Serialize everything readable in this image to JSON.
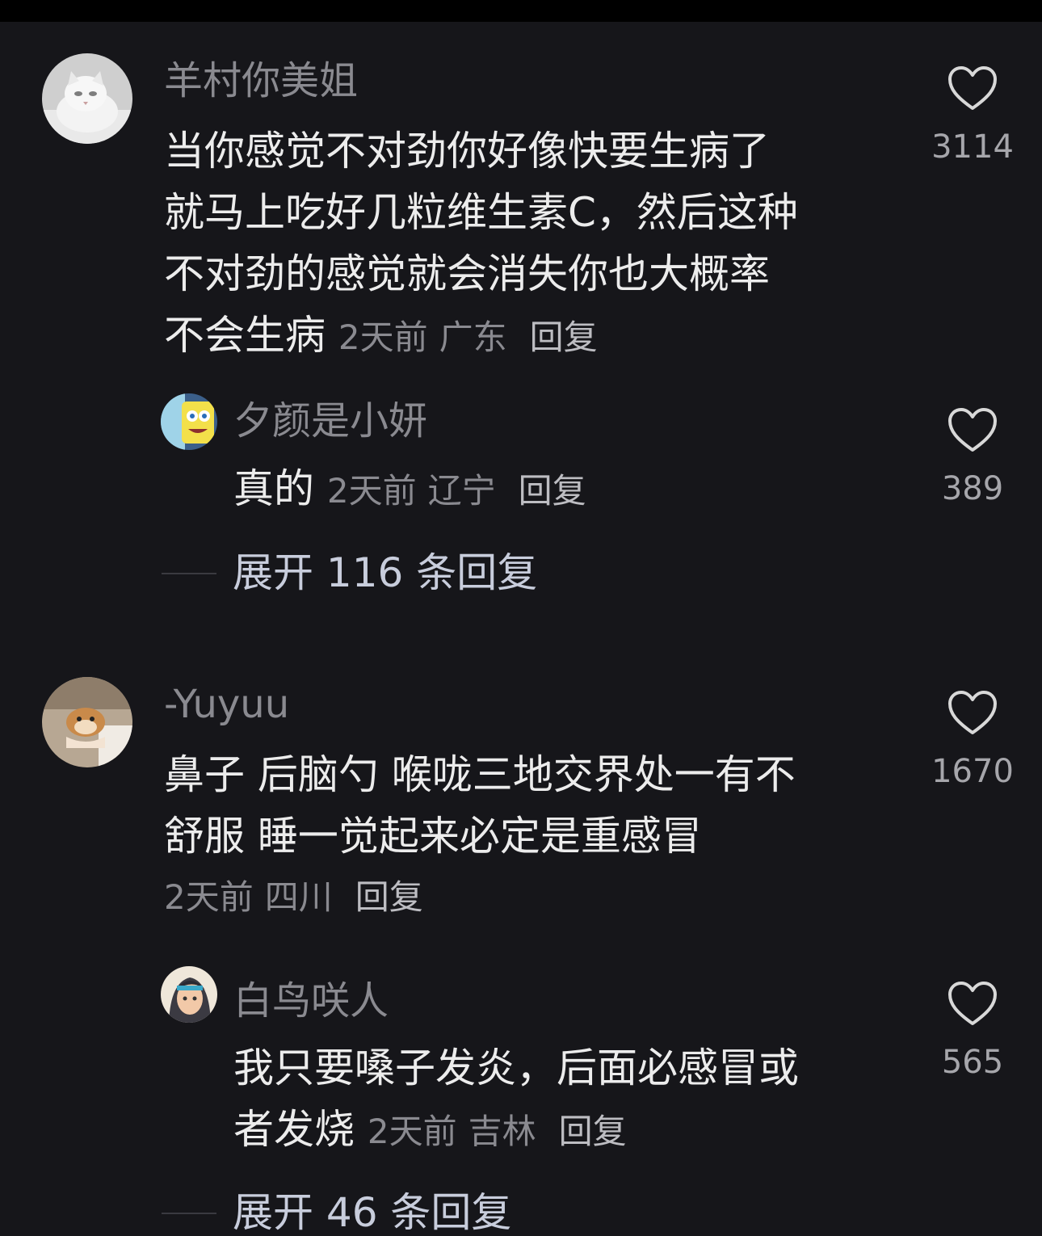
{
  "comments": [
    {
      "username": "羊村你美姐",
      "lines": [
        "当你感觉不对劲你好像快要生病了",
        "就马上吃好几粒维生素C，然后这种",
        "不对劲的感觉就会消失你也大概率",
        "不会生病"
      ],
      "time": "2天前",
      "location": "广东",
      "reply_label": "回复",
      "likes": "3114",
      "avatar_icon": "white-cat-avatar",
      "replies": [
        {
          "username": "夕颜是小妍",
          "lines": [
            "真的"
          ],
          "time": "2天前",
          "location": "辽宁",
          "reply_label": "回复",
          "likes": "389",
          "avatar_icon": "spongebob-avatar"
        }
      ],
      "expand_label": "展开 116 条回复"
    },
    {
      "username": "-Yuyuu",
      "lines": [
        "鼻子 后脑勺 喉咙三地交界处一有不",
        "舒服 睡一觉起来必定是重感冒"
      ],
      "time": "2天前",
      "location": "四川",
      "reply_label": "回复",
      "likes": "1670",
      "avatar_icon": "hamster-avatar",
      "replies": [
        {
          "username": "白鸟咲人",
          "lines": [
            "我只要嗓子发炎，后面必感冒或",
            "者发烧"
          ],
          "time": "2天前",
          "location": "吉林",
          "reply_label": "回复",
          "likes": "565",
          "avatar_icon": "anime-character-avatar"
        }
      ],
      "expand_label": "展开 46 条回复"
    }
  ],
  "colors": {
    "background": "#16161a",
    "text": "#ececec",
    "muted": "#8a8a90",
    "expand": "#c8cddc"
  }
}
